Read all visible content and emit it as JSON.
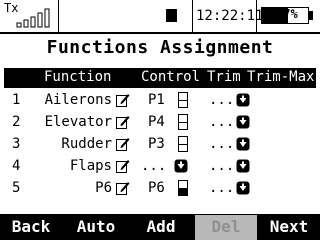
{
  "status": {
    "tx_label": "Tx",
    "clock": "12:22:11",
    "battery_percent": 57,
    "battery_text": "57%",
    "tx_signal_bars": 5
  },
  "title": "Functions Assignment",
  "columns": {
    "function": "Function",
    "control": "Control",
    "trim": "Trim",
    "trim_max": "Trim-Max"
  },
  "rows": [
    {
      "num": "1",
      "function": "Ailerons",
      "control": "P1",
      "control_icon": "axis-indicator",
      "trim": "...",
      "trim_icon": "down-arrow-button"
    },
    {
      "num": "2",
      "function": "Elevator",
      "control": "P4",
      "control_icon": "axis-indicator",
      "trim": "...",
      "trim_icon": "down-arrow-button"
    },
    {
      "num": "3",
      "function": "Rudder",
      "control": "P3",
      "control_icon": "axis-indicator",
      "trim": "...",
      "trim_icon": "down-arrow-button"
    },
    {
      "num": "4",
      "function": "Flaps",
      "control": "...",
      "control_icon": "down-arrow-button",
      "trim": "...",
      "trim_icon": "down-arrow-button"
    },
    {
      "num": "5",
      "function": "P6",
      "control": "P6",
      "control_icon": "filled-indicator",
      "trim": "...",
      "trim_icon": "down-arrow-button"
    }
  ],
  "softkeys": {
    "back": "Back",
    "auto": "Auto",
    "add": "Add",
    "del": "Del",
    "next": "Next"
  },
  "colors": {
    "foreground": "#000000",
    "background": "#ffffff",
    "disabled_key": "#b8b8b8"
  }
}
